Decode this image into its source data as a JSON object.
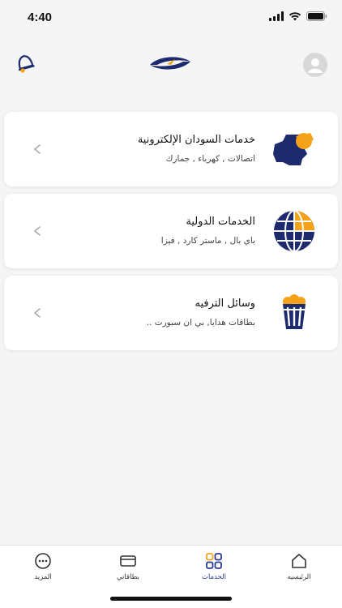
{
  "status_bar": {
    "time": "4:40"
  },
  "colors": {
    "brand_navy": "#1d2a6e",
    "brand_orange": "#f5a21b",
    "active_tab": "#2a3a8f"
  },
  "header": {
    "left_icon": "bell-icon",
    "center_icon": "brand-logo",
    "right_icon": "user-avatar-icon"
  },
  "services": [
    {
      "title": "خدمات السودان الإلكترونية",
      "subtitle": "اتصالات , كهرباء , جمارك",
      "icon": "sudan-map-icon"
    },
    {
      "title": "الخدمات الدولية",
      "subtitle": "باي بال , ماستر كارد , فيزا",
      "icon": "globe-icon"
    },
    {
      "title": "وسائل الترفيه",
      "subtitle": "بطاقات هدايا, بي ان سبورت ..",
      "icon": "popcorn-icon"
    }
  ],
  "tabbar": {
    "items": [
      {
        "label": "المزيد",
        "icon": "more-icon"
      },
      {
        "label": "بطاقاتي",
        "icon": "card-icon"
      },
      {
        "label": "الخدمات",
        "icon": "services-grid-icon",
        "active": true
      },
      {
        "label": "الرئيسيه",
        "icon": "home-icon"
      }
    ]
  }
}
